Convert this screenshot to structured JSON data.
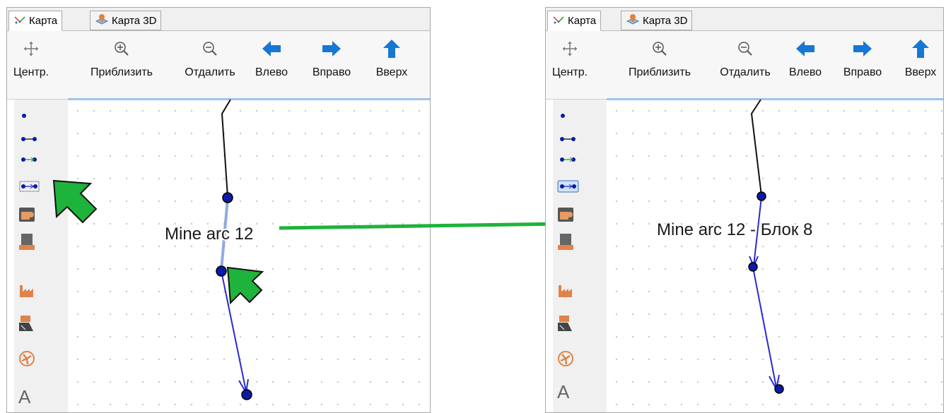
{
  "tabs": {
    "map": "Карта",
    "map3d": "Карта 3D"
  },
  "toolbar": {
    "center": "Центр.",
    "zoom_in": "Приблизить",
    "zoom_out": "Отдалить",
    "left": "Влево",
    "right": "Вправо",
    "up": "Вверх"
  },
  "tools": [
    "point-icon",
    "line-icon",
    "arc-icon",
    "directed-arc-icon",
    "storage-icon",
    "machine-icon",
    "factory-icon",
    "loader-icon",
    "fan-icon",
    "text-icon"
  ],
  "text_tool_glyph": "A",
  "labels": {
    "before": "Mine arc 12",
    "after": "Mine arc 12 - Блок 8"
  },
  "colors": {
    "arrow_green": "#1eb33b",
    "arc_blue": "#2b2bd1",
    "node_fill": "#0b1aa8",
    "accent_blue": "#1777d4"
  }
}
